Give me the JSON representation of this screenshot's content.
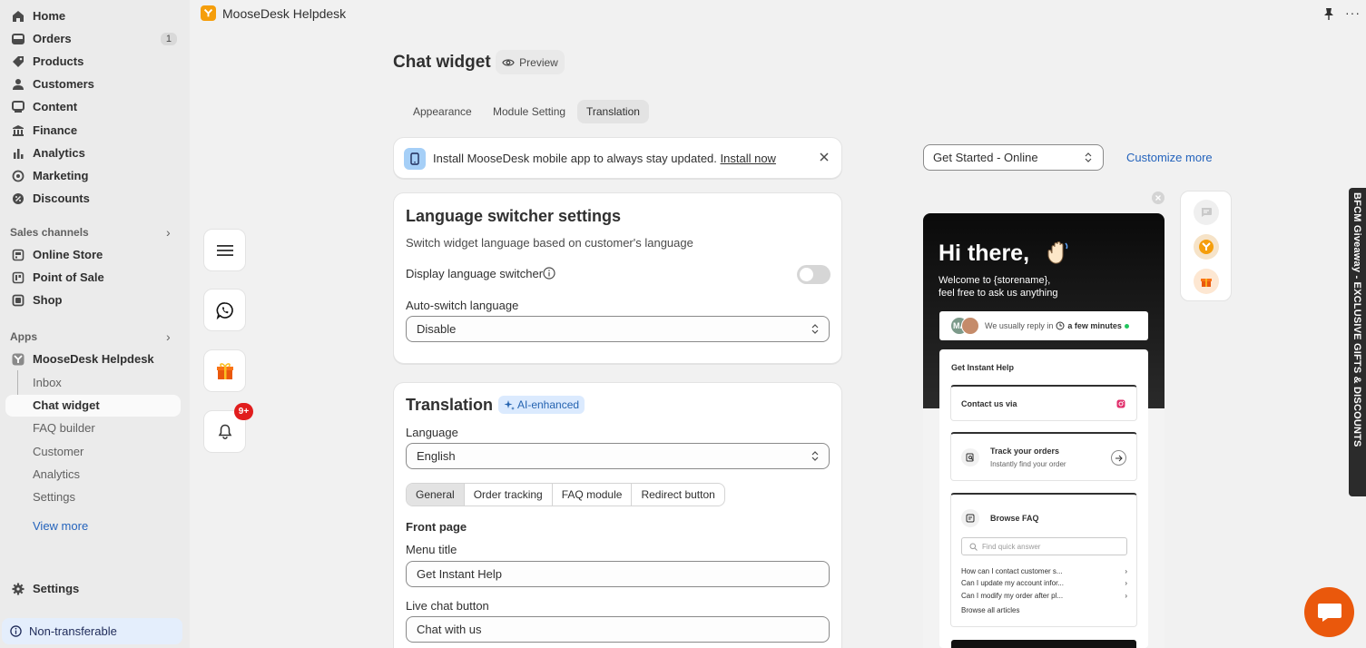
{
  "sidebar": {
    "nav": [
      {
        "label": "Home",
        "icon": "home-icon"
      },
      {
        "label": "Orders",
        "icon": "orders-icon",
        "count": "1"
      },
      {
        "label": "Products",
        "icon": "tag-icon"
      },
      {
        "label": "Customers",
        "icon": "person-icon"
      },
      {
        "label": "Content",
        "icon": "content-icon"
      },
      {
        "label": "Finance",
        "icon": "bank-icon"
      },
      {
        "label": "Analytics",
        "icon": "bar-chart-icon"
      },
      {
        "label": "Marketing",
        "icon": "target-icon"
      },
      {
        "label": "Discounts",
        "icon": "discount-icon"
      }
    ],
    "sales_channels_label": "Sales channels",
    "channels": [
      {
        "label": "Online Store",
        "icon": "store-icon"
      },
      {
        "label": "Point of Sale",
        "icon": "pos-icon"
      },
      {
        "label": "Shop",
        "icon": "shop-icon"
      }
    ],
    "apps_label": "Apps",
    "app_name": "MooseDesk Helpdesk",
    "app_items": [
      "Inbox",
      "Chat widget",
      "FAQ builder",
      "Customer",
      "Analytics",
      "Settings"
    ],
    "view_more": "View more",
    "settings": "Settings",
    "non_transferable": "Non-transferable"
  },
  "topbar": {
    "app_title": "MooseDesk Helpdesk",
    "more": "···"
  },
  "page": {
    "title": "Chat widget",
    "preview": "Preview",
    "tabs": [
      "Appearance",
      "Module Setting",
      "Translation"
    ],
    "selected_tab": "Translation"
  },
  "banner": {
    "text": "Install MooseDesk mobile app to always stay updated.",
    "link": "Install now"
  },
  "language_switcher": {
    "title": "Language switcher settings",
    "description": "Switch widget language based on customer's language",
    "display_label": "Display language switcher",
    "display_enabled": false,
    "auto_switch_label": "Auto-switch language",
    "auto_switch_value": "Disable"
  },
  "translation": {
    "title": "Translation",
    "ai_badge": "AI-enhanced",
    "language_label": "Language",
    "language_value": "English",
    "segments": [
      "General",
      "Order tracking",
      "FAQ module",
      "Redirect button"
    ],
    "selected_segment": "General",
    "front_page": "Front page",
    "menu_title_label": "Menu title",
    "menu_title_value": "Get Instant Help",
    "live_chat_label": "Live chat button",
    "live_chat_value": "Chat with us"
  },
  "preview_panel": {
    "status_select": "Get Started - Online",
    "customize_more": "Customize more",
    "greeting": "Hi there,",
    "welcome_line1": "Welcome to {storename},",
    "welcome_line2": "feel free to ask us anything",
    "avatar_initials": "MA",
    "reply_prefix": "We usually reply in",
    "reply_time": "a few minutes",
    "get_instant_help": "Get Instant Help",
    "contact_us": "Contact us via",
    "track_title": "Track your orders",
    "track_sub": "Instantly find your order",
    "browse_faq": "Browse FAQ",
    "faq_search_placeholder": "Find quick answer",
    "faq_questions": [
      "How can I contact customer s...",
      "Can I update my account infor...",
      "Can I modify my order after pl..."
    ],
    "browse_all": "Browse all articles"
  },
  "floating": {
    "badge": "9+"
  },
  "promo_tab": "BFCM Giveaway - EXCLUSIVE GIFTS & DISCOUNTS",
  "colors": {
    "accent_link": "#2463bc",
    "brand_orange": "#f59e0b",
    "badge_red": "#e11d1d",
    "chat_fab": "#ea580c"
  }
}
